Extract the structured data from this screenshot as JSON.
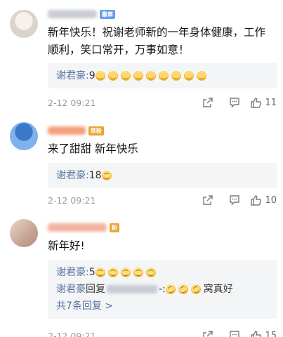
{
  "comments": [
    {
      "badge": "徽章",
      "text": "新年快乐！祝谢老师新的一年身体健康，工作顺利，笑口常开，万事如意！",
      "replies": [
        {
          "name": "谢君豪:",
          "text": "9",
          "emoji_count": 9
        }
      ],
      "time": "2-12 09:21",
      "likes": "11"
    },
    {
      "badge": "铁粉",
      "text": "来了甜甜 新年快乐",
      "replies": [
        {
          "name": "谢君豪:",
          "text": "18",
          "emoji_count": 1
        }
      ],
      "time": "2-12 09:21",
      "likes": "10"
    },
    {
      "badge": "粉",
      "text": "新年好!",
      "replies": [
        {
          "name": "谢君豪:",
          "text": "5",
          "emoji_count": 5
        },
        {
          "name": "谢君豪",
          "reply_word": "回复",
          "suffix": "-:",
          "tail": "窝真好",
          "emoji_count": 3
        }
      ],
      "more": "共7条回复 >",
      "time": "2-12 09:21",
      "likes": "15"
    }
  ],
  "icons": {
    "share": "share-icon",
    "comment": "comment-icon",
    "like": "thumbs-up-icon"
  },
  "colors": {
    "reply_name": "#55729e",
    "reply_bg": "#f4f5f7",
    "time": "#9a9a9a"
  }
}
